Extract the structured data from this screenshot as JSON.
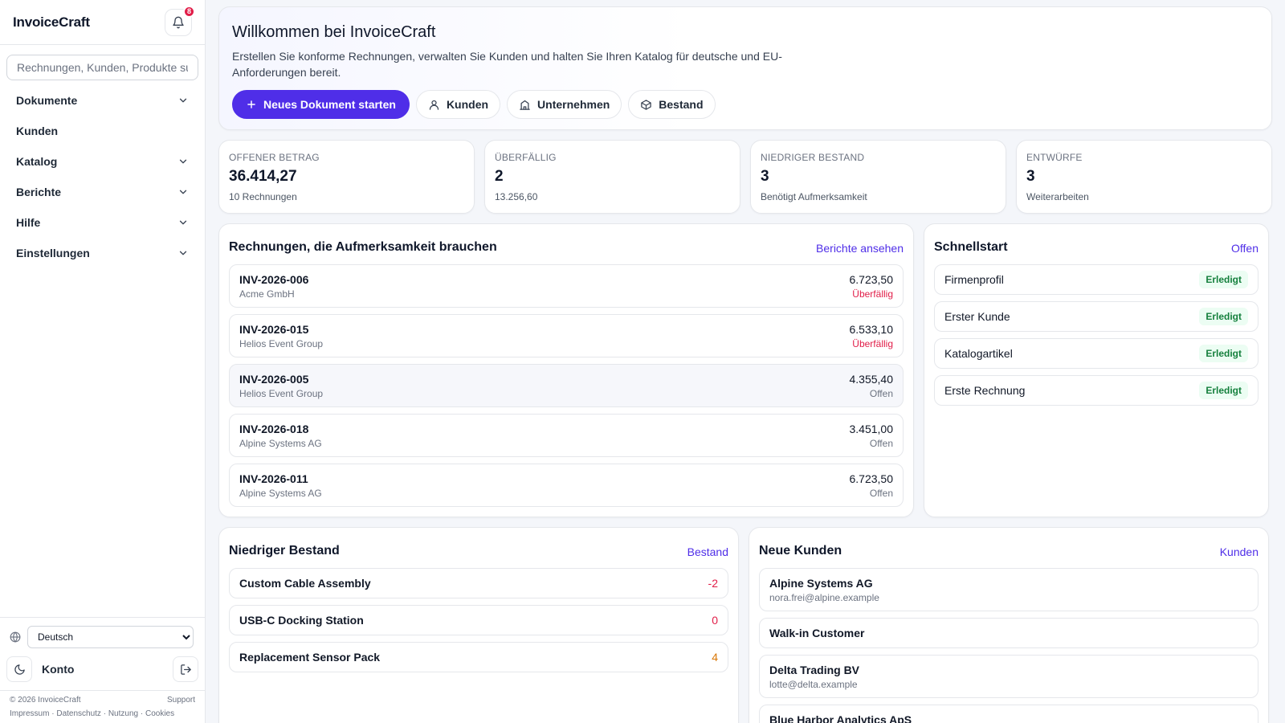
{
  "app": {
    "brand": "InvoiceCraft",
    "notification_count": "8"
  },
  "colors": {
    "accent": "#4f2ee8",
    "danger": "#e11d48",
    "warning": "#d97706",
    "success": "#15803d"
  },
  "search": {
    "placeholder": "Rechnungen, Kunden, Produkte su"
  },
  "sidebar": {
    "items": [
      {
        "label": "Dokumente",
        "has_chevron": true
      },
      {
        "label": "Kunden",
        "has_chevron": false
      },
      {
        "label": "Katalog",
        "has_chevron": true
      },
      {
        "label": "Berichte",
        "has_chevron": true
      },
      {
        "label": "Hilfe",
        "has_chevron": true
      },
      {
        "label": "Einstellungen",
        "has_chevron": true
      }
    ],
    "language": "Deutsch",
    "account_label": "Konto"
  },
  "footer": {
    "copyright": "© 2026 InvoiceCraft",
    "support": "Support",
    "links": [
      "Impressum",
      "Datenschutz",
      "Nutzung",
      "Cookies"
    ]
  },
  "hero": {
    "title": "Willkommen bei InvoiceCraft",
    "description": "Erstellen Sie konforme Rechnungen, verwalten Sie Kunden und halten Sie Ihren Katalog für deutsche und EU-Anforderungen bereit.",
    "primary_action": "Neues Dokument starten",
    "actions": [
      "Kunden",
      "Unternehmen",
      "Bestand"
    ]
  },
  "stats": [
    {
      "label": "Offener Betrag",
      "value": "36.414,27",
      "sub": "10 Rechnungen"
    },
    {
      "label": "Überfällig",
      "value": "2",
      "sub": "13.256,60"
    },
    {
      "label": "Niedriger Bestand",
      "value": "3",
      "sub": "Benötigt Aufmerksamkeit"
    },
    {
      "label": "Entwürfe",
      "value": "3",
      "sub": "Weiterarbeiten"
    }
  ],
  "attention": {
    "title": "Rechnungen, die Aufmerksamkeit brauchen",
    "link": "Berichte ansehen",
    "invoices": [
      {
        "number": "INV-2026-006",
        "customer": "Acme GmbH",
        "amount": "6.723,50",
        "status": "Überfällig"
      },
      {
        "number": "INV-2026-015",
        "customer": "Helios Event Group",
        "amount": "6.533,10",
        "status": "Überfällig"
      },
      {
        "number": "INV-2026-005",
        "customer": "Helios Event Group",
        "amount": "4.355,40",
        "status": "Offen"
      },
      {
        "number": "INV-2026-018",
        "customer": "Alpine Systems AG",
        "amount": "3.451,00",
        "status": "Offen"
      },
      {
        "number": "INV-2026-011",
        "customer": "Alpine Systems AG",
        "amount": "6.723,50",
        "status": "Offen"
      }
    ]
  },
  "quickstart": {
    "title": "Schnellstart",
    "link": "Offen",
    "items": [
      {
        "label": "Firmenprofil",
        "status": "Erledigt"
      },
      {
        "label": "Erster Kunde",
        "status": "Erledigt"
      },
      {
        "label": "Katalogartikel",
        "status": "Erledigt"
      },
      {
        "label": "Erste Rechnung",
        "status": "Erledigt"
      }
    ]
  },
  "low_stock": {
    "title": "Niedriger Bestand",
    "link": "Bestand",
    "items": [
      {
        "name": "Custom Cable Assembly",
        "qty": "-2"
      },
      {
        "name": "USB-C Docking Station",
        "qty": "0"
      },
      {
        "name": "Replacement Sensor Pack",
        "qty": "4"
      }
    ]
  },
  "new_customers": {
    "title": "Neue Kunden",
    "link": "Kunden",
    "items": [
      {
        "name": "Alpine Systems AG",
        "email": "nora.frei@alpine.example"
      },
      {
        "name": "Walk-in Customer",
        "email": ""
      },
      {
        "name": "Delta Trading BV",
        "email": "lotte@delta.example"
      },
      {
        "name": "Blue Harbor Analytics ApS",
        "email": ""
      }
    ]
  }
}
